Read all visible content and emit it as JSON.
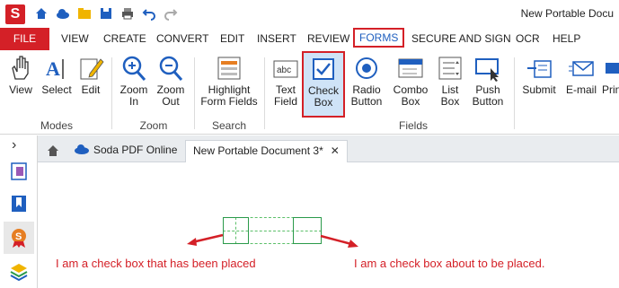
{
  "app": {
    "logo_letter": "S",
    "doc_title": "New Portable Docu"
  },
  "quick_access": [
    "home-icon",
    "cloud-icon",
    "folder-icon",
    "save-icon",
    "print-icon",
    "undo-icon",
    "redo-icon"
  ],
  "menu": {
    "file": "FILE",
    "tabs": [
      "VIEW",
      "CREATE",
      "CONVERT",
      "EDIT",
      "INSERT",
      "REVIEW",
      "FORMS",
      "SECURE AND SIGN",
      "OCR",
      "HELP"
    ],
    "active_tab": "FORMS"
  },
  "ribbon": {
    "view": "View",
    "select": "Select",
    "edit": "Edit",
    "zoom_in": "Zoom\nIn",
    "zoom_out": "Zoom\nOut",
    "highlight": "Highlight\nForm Fields",
    "text_field": "Text\nField",
    "check_box": "Check\nBox",
    "radio": "Radio\nButton",
    "combo": "Combo\nBox",
    "list": "List\nBox",
    "push": "Push\nButton",
    "submit": "Submit",
    "email": "E-mail",
    "print": "Prin",
    "groups": {
      "modes": "Modes",
      "zoom": "Zoom",
      "search": "Search",
      "fields": "Fields"
    }
  },
  "doc_tabs": {
    "online": "Soda PDF Online",
    "current": "New Portable Document 3*",
    "close": "✕"
  },
  "sidebar": {
    "expand": "›"
  },
  "annotations": {
    "left": "I am a check box that has been placed",
    "right": "I am a check box about to be placed."
  },
  "colors": {
    "brand": "#d42027",
    "accent": "#1f5fbf",
    "field_border": "#2a9a4a"
  }
}
